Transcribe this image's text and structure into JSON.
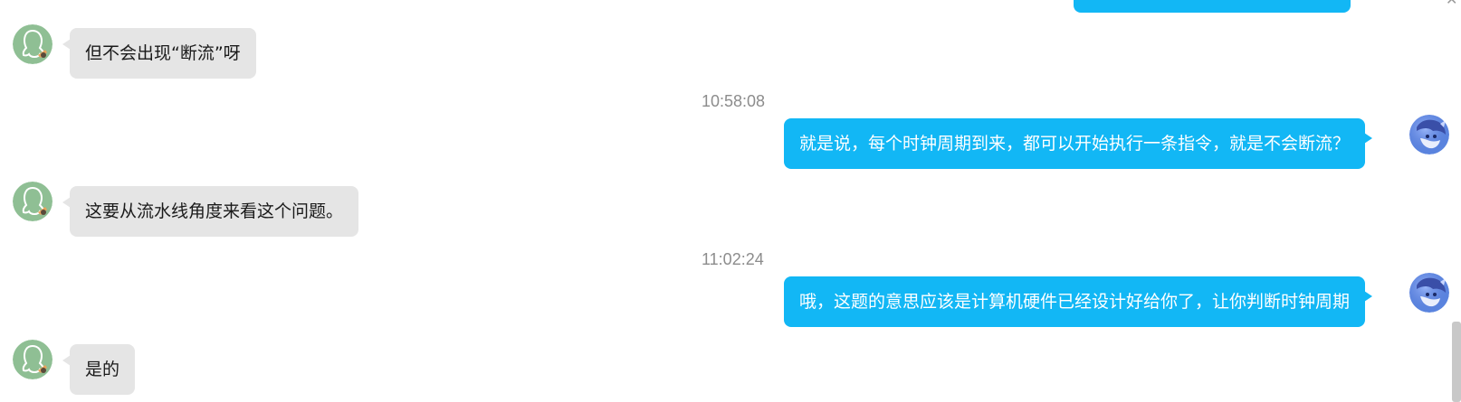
{
  "conversation": {
    "top_partial_message": "",
    "messages": [
      {
        "sender": "other",
        "text": "但不会出现“断流”呀"
      },
      {
        "time": "10:58:08"
      },
      {
        "sender": "self",
        "text": "就是说，每个时钟周期到来，都可以开始执行一条指令，就是不会断流？"
      },
      {
        "sender": "other",
        "text": "这要从流水线角度来看这个问题。"
      },
      {
        "time": "11:02:24"
      },
      {
        "sender": "self",
        "text": "哦，这题的意思应该是计算机硬件已经设计好给你了，让你判断时钟周期"
      },
      {
        "sender": "other",
        "text": "是的"
      }
    ]
  },
  "avatars": {
    "other": {
      "icon": "default-qq-avatar-icon",
      "color": "#8fbf94"
    },
    "self": {
      "icon": "anime-character-avatar-icon",
      "color": "#5b86e0"
    }
  },
  "colors": {
    "incoming_bubble": "#e5e5e5",
    "outgoing_bubble": "#12b7f5",
    "timestamp": "#8c8c8c"
  }
}
